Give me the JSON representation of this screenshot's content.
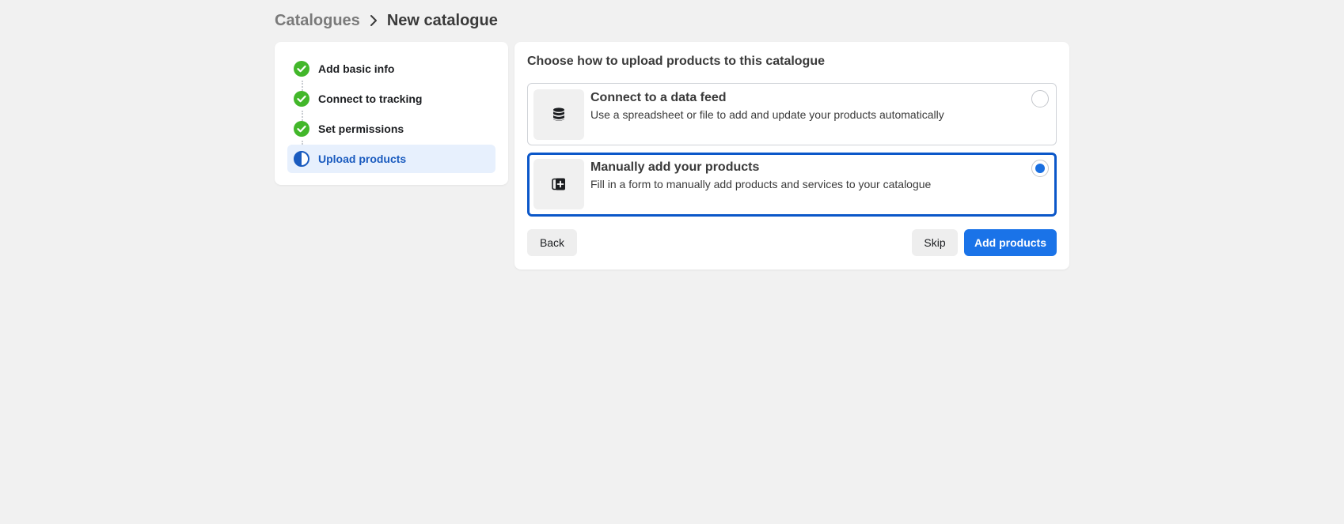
{
  "breadcrumb": {
    "parent": "Catalogues",
    "current": "New catalogue"
  },
  "steps": [
    {
      "label": "Add basic info",
      "status": "complete"
    },
    {
      "label": "Connect to tracking",
      "status": "complete"
    },
    {
      "label": "Set permissions",
      "status": "complete"
    },
    {
      "label": "Upload products",
      "status": "in-progress"
    }
  ],
  "main": {
    "title": "Choose how to upload products to this catalogue",
    "options": [
      {
        "title": "Connect to a data feed",
        "description": "Use a spreadsheet or file to add and update your products automatically",
        "icon": "database-icon",
        "selected": false
      },
      {
        "title": "Manually add your products",
        "description": "Fill in a form to manually add products and services to your catalogue",
        "icon": "add-product-icon",
        "selected": true
      }
    ]
  },
  "buttons": {
    "back": "Back",
    "skip": "Skip",
    "add_products": "Add products"
  },
  "colors": {
    "page_background": "#f1f1f1",
    "step_complete": "#42b72a",
    "step_active_text": "#1a5bbf",
    "step_active_bg": "#e7f0fd",
    "selected_border": "#0b57c9",
    "primary_button": "#1a73e8"
  }
}
